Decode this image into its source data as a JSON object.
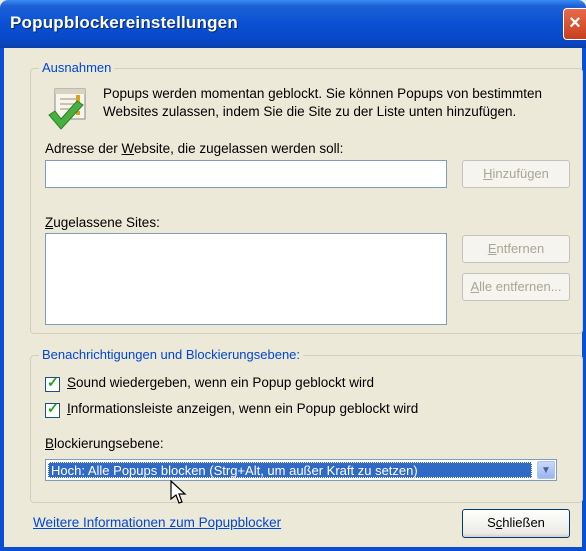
{
  "window": {
    "title": "Popupblockereinstellungen",
    "close_label": "×"
  },
  "exceptions": {
    "legend": "Ausnahmen",
    "description": "Popups werden momentan geblockt. Sie können Popups von bestimmten Websites zulassen, indem Sie die Site zu der Liste unten hinzufügen.",
    "address_label_pre": "Adresse der ",
    "address_label_key": "W",
    "address_label_post": "ebsite, die zugelassen werden soll:",
    "address_value": "",
    "add_key": "H",
    "add_rest": "inzufügen",
    "allowed_key": "Z",
    "allowed_rest": "ugelassene Sites:",
    "allowed_sites": [],
    "remove_key": "E",
    "remove_rest": "ntfernen",
    "remove_all_key": "A",
    "remove_all_rest": "lle entfernen..."
  },
  "notifications": {
    "legend": "Benachrichtigungen und Blockierungsebene:",
    "sound_key": "S",
    "sound_rest": "ound wiedergeben, wenn ein Popup geblockt wird",
    "sound_checked": true,
    "infobar_key": "I",
    "infobar_rest": "nformationsleiste anzeigen, wenn ein Popup geblockt wird",
    "infobar_checked": true,
    "level_key": "B",
    "level_rest": "lockierungsebene:",
    "level_value": "Hoch: Alle Popups blocken (Strg+Alt, um außer Kraft zu setzen)"
  },
  "footer": {
    "more_info_link": "Weitere Informationen zum Popupblocker",
    "close_pre": "S",
    "close_key": "c",
    "close_post": "hließen"
  },
  "colors": {
    "title_blue": "#0a4fd3",
    "dialog_bg": "#ECE9D8",
    "legend_blue": "#0046d5",
    "selection": "#316ac5"
  }
}
